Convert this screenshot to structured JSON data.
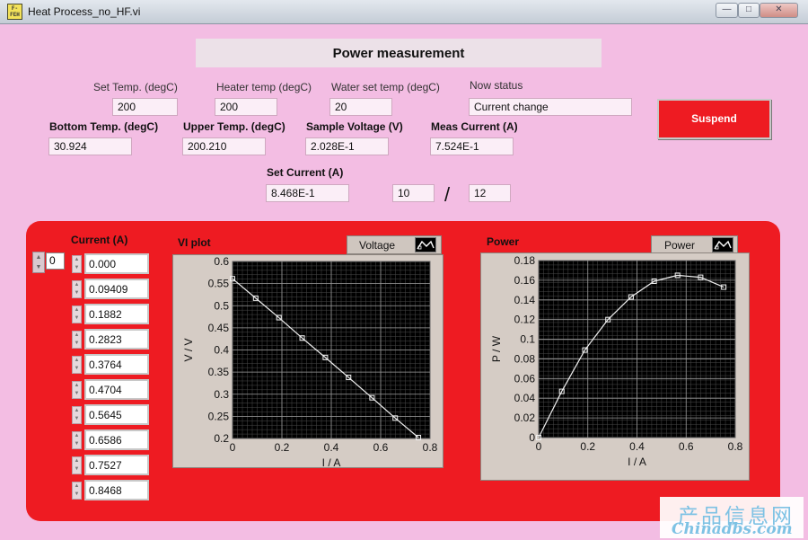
{
  "window": {
    "title": "Heat Process_no_HF.vi",
    "icon_text": "F- FEH"
  },
  "heading": "Power measurement",
  "fields_row1": [
    {
      "label": "Set Temp. (degC)",
      "value": "200"
    },
    {
      "label": "Heater temp (degC)",
      "value": "200"
    },
    {
      "label": "Water set temp (degC)",
      "value": "20"
    },
    {
      "label": "Now status",
      "value": "Current change"
    }
  ],
  "fields_row2": [
    {
      "label": "Bottom Temp. (degC)",
      "value": "30.924"
    },
    {
      "label": "Upper Temp. (degC)",
      "value": "200.210"
    },
    {
      "label": "Sample Voltage (V)",
      "value": "2.028E-1"
    },
    {
      "label": "Meas Current (A)",
      "value": "7.524E-1"
    }
  ],
  "set_current": {
    "label": "Set Current (A)",
    "value": "8.468E-1",
    "step": "10",
    "slash": "/",
    "total": "12"
  },
  "suspend_label": "Suspend",
  "current_array": {
    "label": "Current (A)",
    "index": "0",
    "values": [
      "0.000",
      "0.09409",
      "0.1882",
      "0.2823",
      "0.3764",
      "0.4704",
      "0.5645",
      "0.6586",
      "0.7527",
      "0.8468"
    ]
  },
  "chart_data": [
    {
      "type": "line",
      "title": "VI plot",
      "legend": "Voltage",
      "xlabel": "I / A",
      "ylabel": "V / V",
      "xlim": [
        0,
        0.8
      ],
      "ylim": [
        0.2,
        0.6
      ],
      "xticks": [
        "0",
        "0.2",
        "0.4",
        "0.6",
        "0.8"
      ],
      "yticks": [
        "0.2",
        "0.25",
        "0.3",
        "0.35",
        "0.4",
        "0.45",
        "0.5",
        "0.55",
        "0.6"
      ],
      "grid": true,
      "background": "#000000",
      "line_color": "#f0f0f0",
      "series": [
        {
          "name": "Voltage",
          "x": [
            0,
            0.094,
            0.188,
            0.282,
            0.376,
            0.47,
            0.565,
            0.659,
            0.753
          ],
          "y": [
            0.561,
            0.517,
            0.473,
            0.427,
            0.383,
            0.338,
            0.292,
            0.246,
            0.202
          ]
        }
      ]
    },
    {
      "type": "line",
      "title": "Power",
      "legend": "Power",
      "xlabel": "I / A",
      "ylabel": "P / W",
      "xlim": [
        0,
        0.8
      ],
      "ylim": [
        0,
        0.18
      ],
      "xticks": [
        "0",
        "0.2",
        "0.4",
        "0.6",
        "0.8"
      ],
      "yticks": [
        "0",
        "0.02",
        "0.04",
        "0.06",
        "0.08",
        "0.1",
        "0.12",
        "0.14",
        "0.16",
        "0.18"
      ],
      "grid": true,
      "background": "#000000",
      "line_color": "#f0f0f0",
      "series": [
        {
          "name": "Power",
          "x": [
            0,
            0.094,
            0.188,
            0.282,
            0.376,
            0.47,
            0.565,
            0.659,
            0.753
          ],
          "y": [
            0,
            0.047,
            0.089,
            0.12,
            0.143,
            0.159,
            0.165,
            0.163,
            0.153
          ]
        }
      ]
    }
  ],
  "watermark": {
    "line1": "产品信息网",
    "line2": "Chinadbs.com"
  },
  "colors": {
    "panel": "#f3bde3",
    "red_panel": "#ee1b22",
    "button": "#ee1b22"
  }
}
